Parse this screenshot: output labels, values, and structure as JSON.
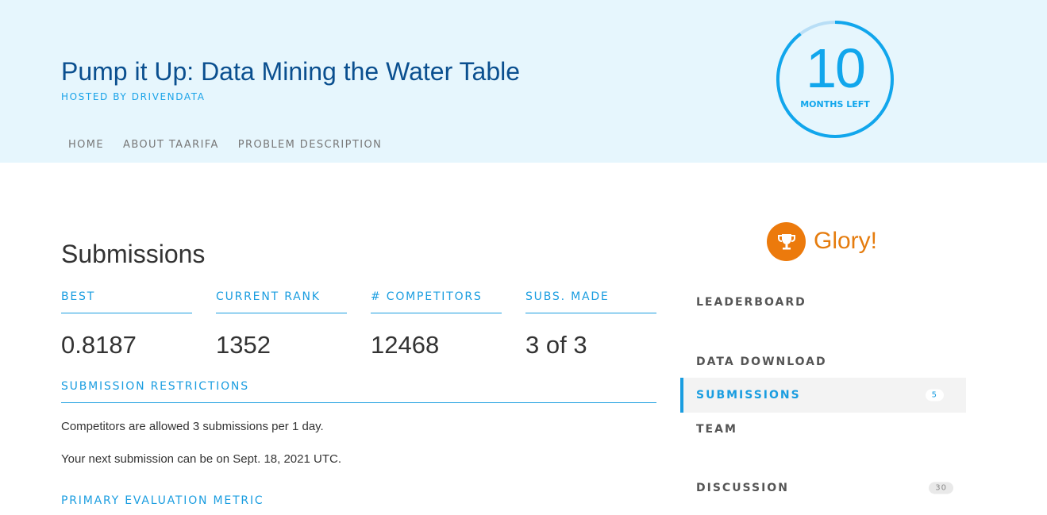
{
  "header": {
    "title": "Pump it Up: Data Mining the Water Table",
    "hosted_by": "HOSTED BY DRIVENDATA",
    "nav": [
      "HOME",
      "ABOUT TAARIFA",
      "PROBLEM DESCRIPTION"
    ],
    "countdown": {
      "number": "10",
      "label": "MONTHS LEFT"
    }
  },
  "main": {
    "section_title": "Submissions",
    "stats": [
      {
        "label": "BEST",
        "value": "0.8187"
      },
      {
        "label": "CURRENT RANK",
        "value": "1352"
      },
      {
        "label": "# COMPETITORS",
        "value": "12468"
      },
      {
        "label": "SUBS. MADE",
        "value": "3 of 3"
      }
    ],
    "restrictions_heading": "SUBMISSION RESTRICTIONS",
    "restriction_lines": [
      "Competitors are allowed 3 submissions per 1 day.",
      "Your next submission can be on Sept. 18, 2021 UTC."
    ],
    "metric_heading": "PRIMARY EVALUATION METRIC"
  },
  "sidebar": {
    "prize_icon": "trophy-icon",
    "prize_text": "Glory!",
    "items": [
      {
        "label": "LEADERBOARD"
      },
      {
        "label": "DATA DOWNLOAD"
      },
      {
        "label": "SUBMISSIONS",
        "badge": "5",
        "active": true
      },
      {
        "label": "TEAM"
      },
      {
        "label": "DISCUSSION",
        "badge": "30"
      }
    ]
  },
  "colors": {
    "header_bg": "#e6f6fd",
    "accent_blue": "#1a9de0",
    "title_blue": "#0a4f8f",
    "prize_orange": "#ec7a0c"
  }
}
